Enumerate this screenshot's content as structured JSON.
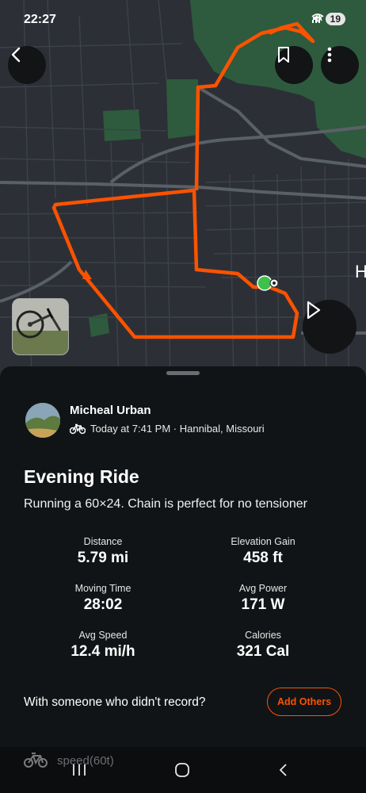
{
  "status_bar": {
    "time": "22:27",
    "battery": "19",
    "signal_icons": "5G signal wifi mute"
  },
  "map": {
    "colors": {
      "route": "#fc5200",
      "park": "#2e5b3e",
      "road": "#454b52",
      "major_road": "#5a6068",
      "background": "#2c3036"
    },
    "label_fragment": "H"
  },
  "toolbar": {
    "back_icon": "chevron-left-icon",
    "bookmark_icon": "bookmark-icon",
    "more_icon": "more-vertical-icon",
    "play_icon": "play-icon"
  },
  "activity": {
    "athlete_name": "Micheal Urban",
    "meta": "Today at 7:41 PM · Hannibal, Missouri",
    "title": "Evening Ride",
    "description": "Running a 60×24. Chain is perfect for no tensioner"
  },
  "stats": [
    {
      "label": "Distance",
      "value": "5.79 mi"
    },
    {
      "label": "Elevation Gain",
      "value": "458 ft"
    },
    {
      "label": "Moving Time",
      "value": "28:02"
    },
    {
      "label": "Avg Power",
      "value": "171 W"
    },
    {
      "label": "Avg Speed",
      "value": "12.4 mi/h"
    },
    {
      "label": "Calories",
      "value": "321 Cal"
    }
  ],
  "others": {
    "prompt": "With someone who didn't record?",
    "button_label": "Add Others"
  },
  "peek": {
    "label": "speed(60t)"
  },
  "accent_color": "#fc5200"
}
